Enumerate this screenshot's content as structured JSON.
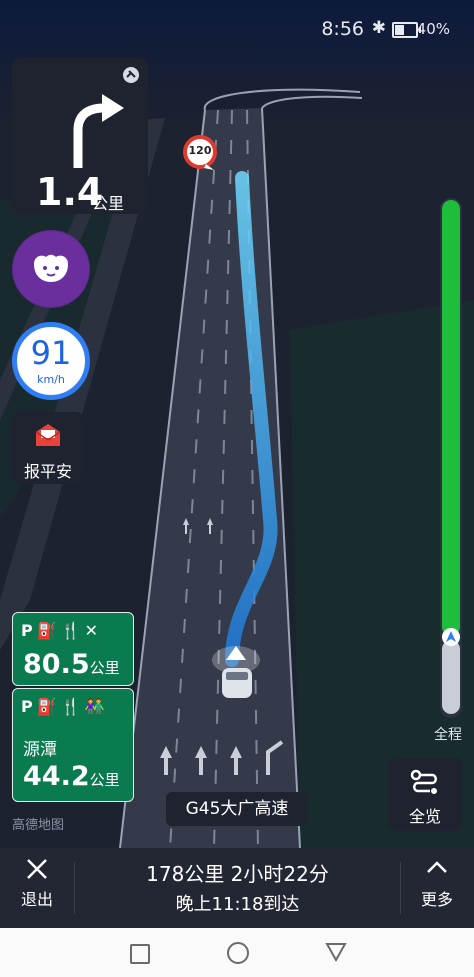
{
  "status_bar": {
    "time": "8:56",
    "battery_percent": "40%",
    "battery_level": 0.4
  },
  "guidance": {
    "distance_value": "1.4",
    "distance_unit": "公里",
    "turn": "right-turn-arrow-icon"
  },
  "speed": {
    "value": "91",
    "unit": "km/h"
  },
  "speed_limit_sign": "120",
  "safety_button": {
    "label": "报平安"
  },
  "service_areas": [
    {
      "icons": "P⛽🍴✕",
      "distance": "80.5",
      "unit": "公里"
    },
    {
      "icons": "P⛽🍴👫",
      "name": "源潭",
      "distance": "44.2",
      "unit": "公里"
    }
  ],
  "route_progress": {
    "label": "全程"
  },
  "overview_button": {
    "label": "全览"
  },
  "road_name": "G45大广高速",
  "map_logo": "高德地图",
  "bottom_bar": {
    "exit_label": "退出",
    "remaining": "178公里 2小时22分",
    "arrival": "晚上11:18到达",
    "more_label": "更多"
  },
  "colors": {
    "progress_green": "#1fbd3c",
    "route_blue": "#23a8f0",
    "service_green": "#0a7a4f",
    "speed_blue": "#1e63e0"
  }
}
